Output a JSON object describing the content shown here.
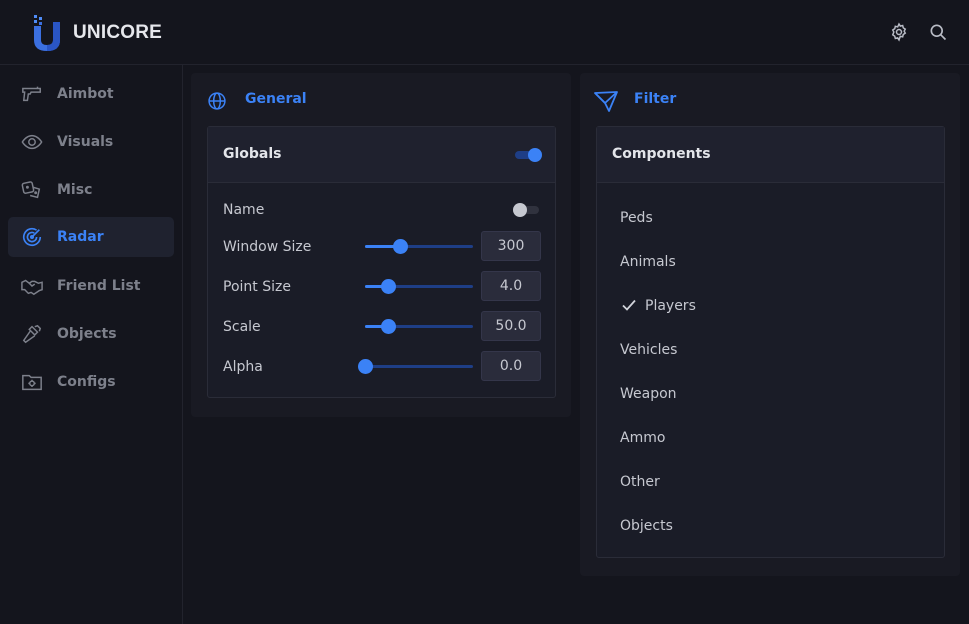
{
  "app": {
    "brand": "UNICORE",
    "accent": "#3b82f6"
  },
  "header": {
    "icons": [
      "gear-icon",
      "search-icon"
    ]
  },
  "sidebar": {
    "items": [
      {
        "label": "Aimbot",
        "icon": "gun-icon",
        "active": false
      },
      {
        "label": "Visuals",
        "icon": "eye-icon",
        "active": false
      },
      {
        "label": "Misc",
        "icon": "dice-icon",
        "active": false
      },
      {
        "label": "Radar",
        "icon": "radar-icon",
        "active": true
      },
      {
        "label": "Friend List",
        "icon": "handshake-icon",
        "active": false
      },
      {
        "label": "Objects",
        "icon": "hammer-icon",
        "active": false
      },
      {
        "label": "Configs",
        "icon": "folder-gear-icon",
        "active": false
      }
    ]
  },
  "general": {
    "title": "General",
    "card_title": "Globals",
    "globals_enabled": true,
    "name_label": "Name",
    "name_enabled": false,
    "sliders": [
      {
        "label": "Window Size",
        "value": "300",
        "fraction": 0.32
      },
      {
        "label": "Point Size",
        "value": "4.0",
        "fraction": 0.21
      },
      {
        "label": "Scale",
        "value": "50.0",
        "fraction": 0.21
      },
      {
        "label": "Alpha",
        "value": "0.0",
        "fraction": 0.0
      }
    ]
  },
  "filter": {
    "title": "Filter",
    "card_title": "Components",
    "items": [
      {
        "label": "Peds",
        "checked": false
      },
      {
        "label": "Animals",
        "checked": false
      },
      {
        "label": "Players",
        "checked": true
      },
      {
        "label": "Vehicles",
        "checked": false
      },
      {
        "label": "Weapon",
        "checked": false
      },
      {
        "label": "Ammo",
        "checked": false
      },
      {
        "label": "Other",
        "checked": false
      },
      {
        "label": "Objects",
        "checked": false
      }
    ]
  }
}
